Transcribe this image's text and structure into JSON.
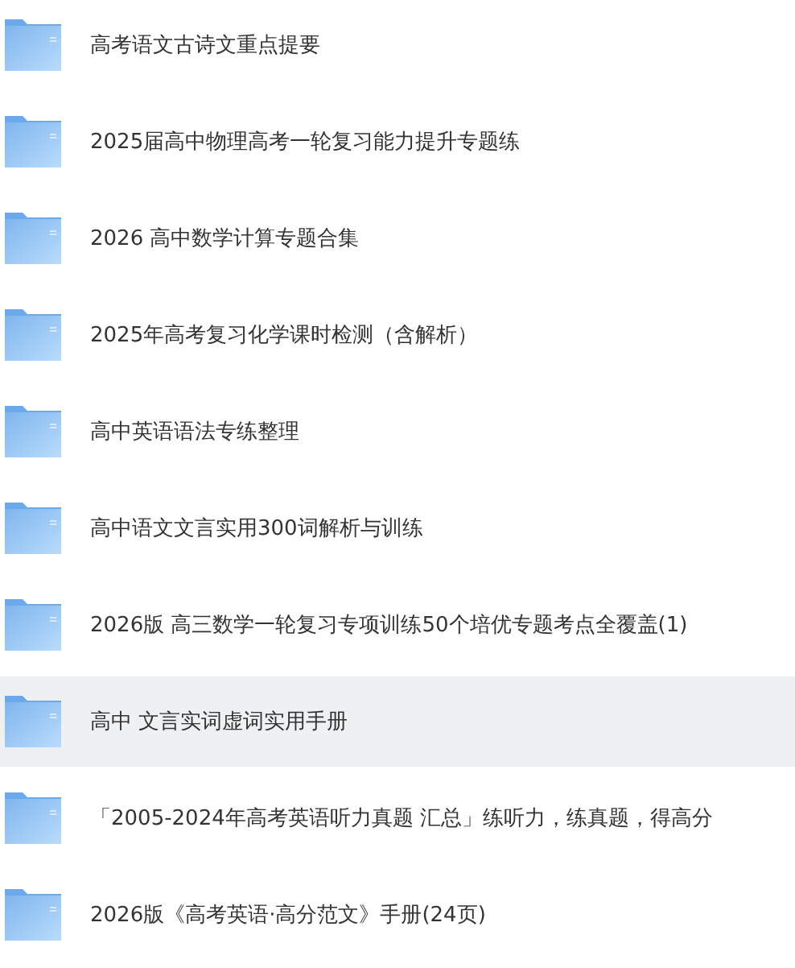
{
  "folders": [
    {
      "name": "高考语文古诗文重点提要",
      "selected": false
    },
    {
      "name": "2025届高中物理高考一轮复习能力提升专题练",
      "selected": false
    },
    {
      "name": "2026 高中数学计算专题合集",
      "selected": false
    },
    {
      "name": "2025年高考复习化学课时检测（含解析）",
      "selected": false
    },
    {
      "name": "高中英语语法专练整理",
      "selected": false
    },
    {
      "name": "高中语文文言实用300词解析与训练",
      "selected": false
    },
    {
      "name": "2026版 高三数学一轮复习专项训练50个培优专题考点全覆盖(1)",
      "selected": false
    },
    {
      "name": "高中 文言实词虚词实用手册",
      "selected": true
    },
    {
      "name": "「2005-2024年高考英语听力真题 汇总」练听力，练真题，得高分",
      "selected": false
    },
    {
      "name": "2026版《高考英语·高分范文》手册(24页)",
      "selected": false
    }
  ]
}
